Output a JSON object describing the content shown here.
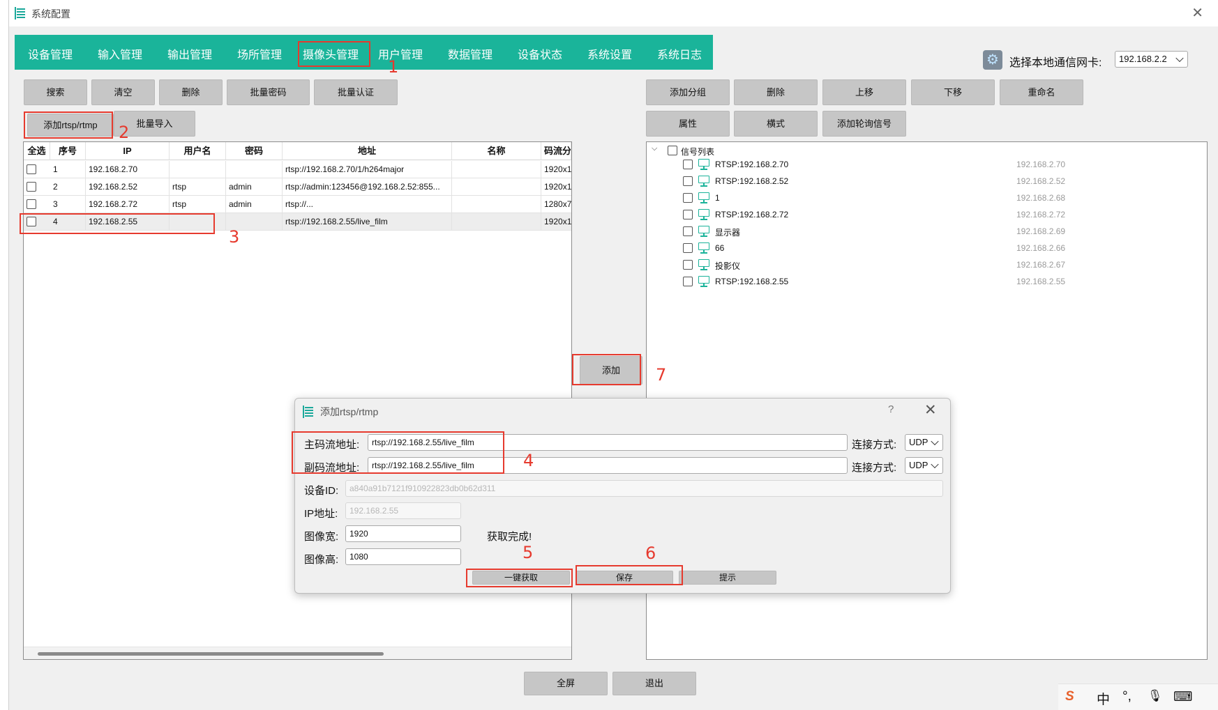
{
  "window": {
    "title": "系统配置",
    "close_label": "✕"
  },
  "nav": {
    "tabs": [
      "设备管理",
      "输入管理",
      "输出管理",
      "场所管理",
      "摄像头管理",
      "用户管理",
      "数据管理",
      "设备状态",
      "系统设置",
      "系统日志"
    ],
    "active_tab": "摄像头管理",
    "accent_color": "#1ab49a"
  },
  "nic": {
    "label": "选择本地通信网卡:",
    "value": "192.168.2.2"
  },
  "left_toolbar": {
    "row1": [
      "搜索",
      "清空",
      "删除",
      "批量密码",
      "批量认证"
    ],
    "row2": [
      "添加rtsp/rtmp",
      "批量导入"
    ]
  },
  "right_toolbar": {
    "row1": [
      "添加分组",
      "删除",
      "上移",
      "下移",
      "重命名"
    ],
    "row2": [
      "属性",
      "横式",
      "添加轮询信号"
    ]
  },
  "table": {
    "columns": [
      "全选",
      "序号",
      "IP",
      "用户名",
      "密码",
      "地址",
      "名称",
      "码流分"
    ],
    "rows": [
      {
        "idx": "1",
        "ip": "192.168.2.70",
        "user": "",
        "pwd": "",
        "addr": "rtsp://192.168.2.70/1/h264major",
        "name": "",
        "res": "1920x1"
      },
      {
        "idx": "2",
        "ip": "192.168.2.52",
        "user": "rtsp",
        "pwd": "admin",
        "addr": "rtsp://admin:123456@192.168.2.52:855...",
        "name": "",
        "res": "1920x1"
      },
      {
        "idx": "3",
        "ip": "192.168.2.72",
        "user": "rtsp",
        "pwd": "admin",
        "addr": "rtsp://...",
        "name": "",
        "res": "1280x7"
      },
      {
        "idx": "4",
        "ip": "192.168.2.55",
        "user": "",
        "pwd": "",
        "addr": "rtsp://192.168.2.55/live_film",
        "name": "",
        "res": "1920x1"
      }
    ]
  },
  "middle_button": "添加",
  "tree": {
    "root": "信号列表",
    "items": [
      {
        "label": "RTSP:192.168.2.70",
        "ip": "192.168.2.70"
      },
      {
        "label": "RTSP:192.168.2.52",
        "ip": "192.168.2.52"
      },
      {
        "label": "1",
        "ip": "192.168.2.68"
      },
      {
        "label": "RTSP:192.168.2.72",
        "ip": "192.168.2.72"
      },
      {
        "label": "显示器",
        "ip": "192.168.2.69"
      },
      {
        "label": "66",
        "ip": "192.168.2.66"
      },
      {
        "label": "投影仪",
        "ip": "192.168.2.67"
      },
      {
        "label": "RTSP:192.168.2.55",
        "ip": "192.168.2.55"
      }
    ]
  },
  "dialog": {
    "title": "添加rtsp/rtmp",
    "help": "?",
    "close": "✕",
    "main_stream_label": "主码流地址:",
    "main_stream_value": "rtsp://192.168.2.55/live_film",
    "sub_stream_label": "副码流地址:",
    "sub_stream_value": "rtsp://192.168.2.55/live_film",
    "conn_label": "连接方式:",
    "conn_value": "UDP",
    "device_id_label": "设备ID:",
    "device_id_value": "a840a91b7121f910922823db0b62d311",
    "ip_label": "IP地址:",
    "ip_value": "192.168.2.55",
    "width_label": "图像宽:",
    "width_value": "1920",
    "height_label": "图像高:",
    "height_value": "1080",
    "fetch_status": "获取完成!",
    "btn_fetch": "一键获取",
    "btn_save": "保存",
    "btn_hint": "提示"
  },
  "bottom": {
    "fullscreen": "全屏",
    "exit": "退出"
  },
  "annotations": [
    "1",
    "2",
    "3",
    "4",
    "5",
    "6",
    "7"
  ],
  "annotation_color": "#e63a2e",
  "ime": {
    "brand": "S",
    "lang": "中",
    "punct": "°,",
    "mic": "🎙",
    "keyboard": "⌨"
  }
}
